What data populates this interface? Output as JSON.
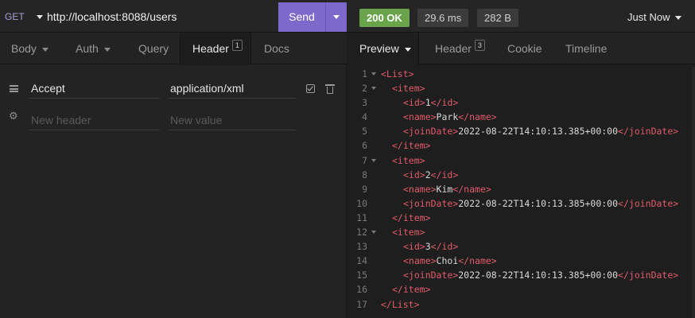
{
  "request": {
    "method": "GET",
    "url": "http://localhost:8088/users",
    "send_label": "Send",
    "tabs": [
      {
        "label": "Body",
        "dropdown": true
      },
      {
        "label": "Auth",
        "dropdown": true
      },
      {
        "label": "Query"
      },
      {
        "label": "Header",
        "badge": "1",
        "active": true
      },
      {
        "label": "Docs"
      }
    ],
    "headers": [
      {
        "name": "Accept",
        "value": "application/xml"
      }
    ],
    "new_header_placeholder": "New header",
    "new_value_placeholder": "New value"
  },
  "response": {
    "status": "200 OK",
    "time": "29.6 ms",
    "size": "282 B",
    "history_label": "Just Now",
    "tabs": [
      {
        "label": "Preview",
        "dropdown": true,
        "active": true
      },
      {
        "label": "Header",
        "badge": "3"
      },
      {
        "label": "Cookie"
      },
      {
        "label": "Timeline"
      }
    ],
    "code_lines": [
      {
        "n": "1",
        "fold": true,
        "indent": 0,
        "open": "<List>",
        "text": "",
        "close": ""
      },
      {
        "n": "2",
        "fold": true,
        "indent": 1,
        "open": "<item>",
        "text": "",
        "close": ""
      },
      {
        "n": "3",
        "fold": false,
        "indent": 2,
        "open": "<id>",
        "text": "1",
        "close": "</id>"
      },
      {
        "n": "4",
        "fold": false,
        "indent": 2,
        "open": "<name>",
        "text": "Park",
        "close": "</name>"
      },
      {
        "n": "5",
        "fold": false,
        "indent": 2,
        "open": "<joinDate>",
        "text": "2022-08-22T14:10:13.385+00:00",
        "close": "</joinDate>"
      },
      {
        "n": "6",
        "fold": false,
        "indent": 1,
        "open": "</item>",
        "text": "",
        "close": ""
      },
      {
        "n": "7",
        "fold": true,
        "indent": 1,
        "open": "<item>",
        "text": "",
        "close": ""
      },
      {
        "n": "8",
        "fold": false,
        "indent": 2,
        "open": "<id>",
        "text": "2",
        "close": "</id>"
      },
      {
        "n": "9",
        "fold": false,
        "indent": 2,
        "open": "<name>",
        "text": "Kim",
        "close": "</name>"
      },
      {
        "n": "10",
        "fold": false,
        "indent": 2,
        "open": "<joinDate>",
        "text": "2022-08-22T14:10:13.385+00:00",
        "close": "</joinDate>"
      },
      {
        "n": "11",
        "fold": false,
        "indent": 1,
        "open": "</item>",
        "text": "",
        "close": ""
      },
      {
        "n": "12",
        "fold": true,
        "indent": 1,
        "open": "<item>",
        "text": "",
        "close": ""
      },
      {
        "n": "13",
        "fold": false,
        "indent": 2,
        "open": "<id>",
        "text": "3",
        "close": "</id>"
      },
      {
        "n": "14",
        "fold": false,
        "indent": 2,
        "open": "<name>",
        "text": "Choi",
        "close": "</name>"
      },
      {
        "n": "15",
        "fold": false,
        "indent": 2,
        "open": "<joinDate>",
        "text": "2022-08-22T14:10:13.385+00:00",
        "close": "</joinDate>"
      },
      {
        "n": "16",
        "fold": false,
        "indent": 1,
        "open": "</item>",
        "text": "",
        "close": ""
      },
      {
        "n": "17",
        "fold": false,
        "indent": 0,
        "open": "</List>",
        "text": "",
        "close": ""
      }
    ]
  },
  "icons": {
    "method_dropdown": "caret-down-icon",
    "row_handle": "drag-handle-icon",
    "new_row": "gear-icon",
    "enable": "checkbox-icon",
    "delete": "trash-icon"
  },
  "colors": {
    "send": "#7d69cb",
    "status_ok": "#69a34a",
    "xml_tag": "#e25a6b",
    "method": "#a7a0d8"
  }
}
